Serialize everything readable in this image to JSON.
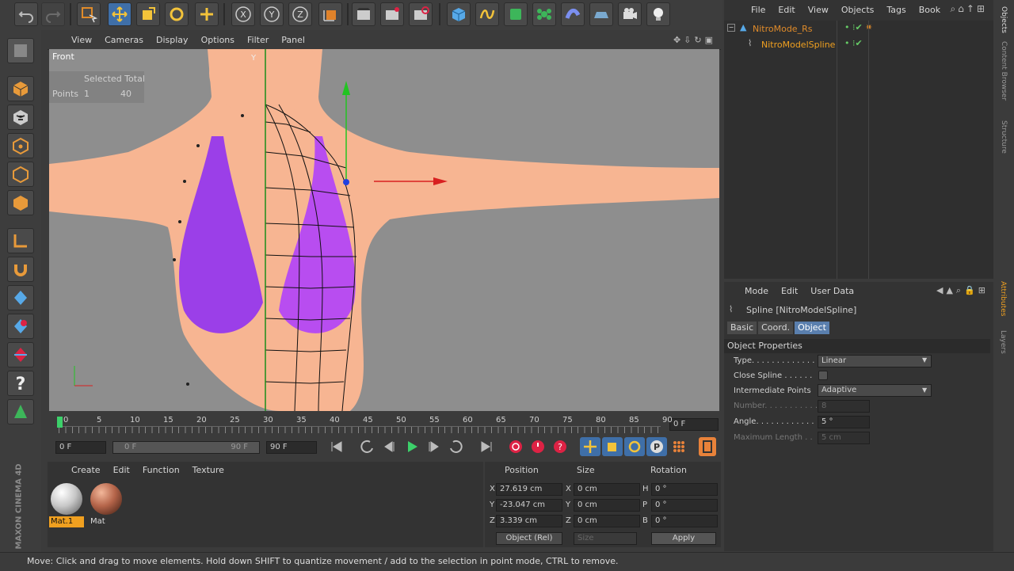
{
  "viewport_menu": [
    "View",
    "Cameras",
    "Display",
    "Options",
    "Filter",
    "Panel"
  ],
  "viewport": {
    "name": "Front",
    "selected_header": "Selected Total",
    "points_label": "Points",
    "points_selected": "1",
    "points_total": "40",
    "axis_label": "Y"
  },
  "objects_menu": [
    "File",
    "Edit",
    "View",
    "Objects",
    "Tags",
    "Book"
  ],
  "objects": [
    {
      "name": "NitroMode_Rs"
    },
    {
      "name": "NitroModelSpline"
    }
  ],
  "right_tabs": [
    "Objects",
    "Content Browser",
    "Structure"
  ],
  "attr_tabs_side": [
    "Attributes",
    "Layers"
  ],
  "attributes": {
    "menu": [
      "Mode",
      "Edit",
      "User Data"
    ],
    "title": "Spline [NitroModelSpline]",
    "tabs": [
      "Basic",
      "Coord.",
      "Object"
    ],
    "section": "Object Properties",
    "type_label": "Type. . . . . . . . . . . . . .",
    "type_value": "Linear",
    "close_label": "Close Spline . . . . . .",
    "intermediate_label": "Intermediate Points",
    "intermediate_value": "Adaptive",
    "number_label": "Number. . . . . . . . . . . .",
    "number_value": "8",
    "angle_label": "Angle. . . . . . . . . . . .",
    "angle_value": "5 °",
    "maxlen_label": "Maximum Length . .",
    "maxlen_value": "5 cm"
  },
  "timeline": {
    "ticks": [
      "0",
      "5",
      "10",
      "15",
      "20",
      "25",
      "30",
      "35",
      "40",
      "45",
      "50",
      "55",
      "60",
      "65",
      "70",
      "75",
      "80",
      "85",
      "90"
    ],
    "current_frame": "0 F",
    "start_field": "0 F",
    "range_start": "0 F",
    "range_end": "90 F",
    "end_field": "90 F"
  },
  "materials": {
    "menu": [
      "Create",
      "Edit",
      "Function",
      "Texture"
    ],
    "items": [
      {
        "name": "Mat.1",
        "color": "#c8c8c8"
      },
      {
        "name": "Mat",
        "color": "#b5654a"
      }
    ]
  },
  "coords": {
    "headers": [
      "Position",
      "Size",
      "Rotation"
    ],
    "rows": [
      {
        "axis": "X",
        "pos": "27.619 cm",
        "size_axis": "X",
        "size": "0 cm",
        "rot_axis": "H",
        "rot": "0 °"
      },
      {
        "axis": "Y",
        "pos": "-23.047 cm",
        "size_axis": "Y",
        "size": "0 cm",
        "rot_axis": "P",
        "rot": "0 °"
      },
      {
        "axis": "Z",
        "pos": "3.339 cm",
        "size_axis": "Z",
        "size": "0 cm",
        "rot_axis": "B",
        "rot": "0 °"
      }
    ],
    "mode": "Object (Rel)",
    "size_mode": "Size",
    "apply": "Apply"
  },
  "status": "Move: Click and drag to move elements. Hold down SHIFT to quantize movement / add to the selection in point mode, CTRL to remove.",
  "brand": "MAXON CINEMA 4D",
  "colors": {
    "accent": "#3f6fa8",
    "highlight": "#f0a020",
    "skin": "#f7b592",
    "bikini": "#9b3fe8"
  }
}
